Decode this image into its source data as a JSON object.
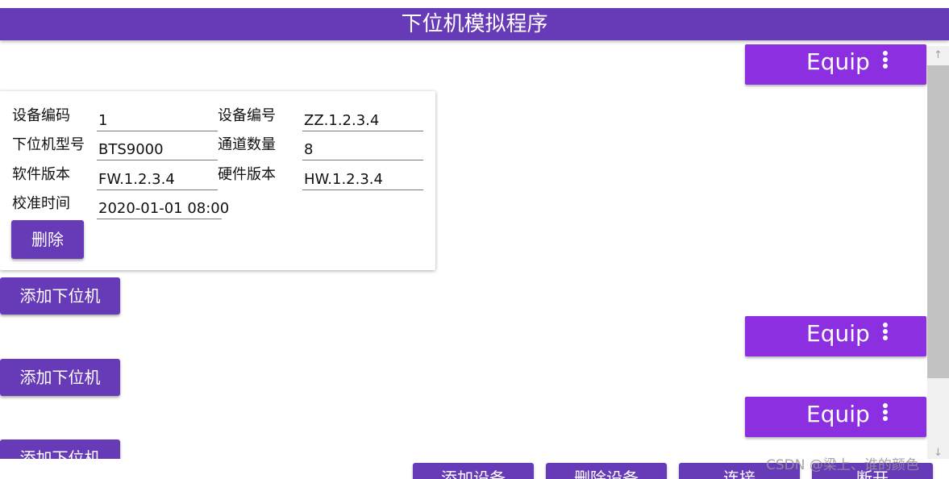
{
  "app": {
    "title": "下位机模拟程序"
  },
  "equip_buttons": [
    {
      "label": "Equip",
      "menu_icon": "more-vert-icon"
    },
    {
      "label": "Equip",
      "menu_icon": "more-vert-icon"
    },
    {
      "label": "Equip",
      "menu_icon": "more-vert-icon"
    }
  ],
  "device_card": {
    "fields": {
      "device_code": {
        "label": "设备编码",
        "value": "1"
      },
      "device_number": {
        "label": "设备编号",
        "value": "ZZ.1.2.3.4"
      },
      "model": {
        "label": "下位机型号",
        "value": "BTS9000"
      },
      "channel_count": {
        "label": "通道数量",
        "value": "8"
      },
      "software_version": {
        "label": "软件版本",
        "value": "FW.1.2.3.4"
      },
      "hardware_version": {
        "label": "硬件版本",
        "value": "HW.1.2.3.4"
      },
      "calibration_time": {
        "label": "校准时间",
        "value": "2020-01-01 08:00"
      }
    },
    "delete_label": "删除"
  },
  "add_lower_buttons": [
    {
      "label": "添加下位机"
    },
    {
      "label": "添加下位机"
    },
    {
      "label": "添加下位机"
    }
  ],
  "bottom_bar": {
    "add_device": "添加设备",
    "delete_device": "删除设备",
    "connect": "连接",
    "disconnect": "断开"
  },
  "scrollbar": {
    "up_icon": "arrow-up-icon",
    "down_icon": "arrow-down-icon"
  },
  "watermark": "CSDN @梁上、谁的颜色",
  "colors": {
    "primary": "#673ab7",
    "equip": "#8b2fe0",
    "background": "#ffffff"
  }
}
